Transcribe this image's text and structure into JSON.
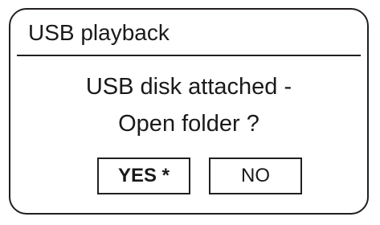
{
  "dialog": {
    "title": "USB playback",
    "message_line1": "USB disk attached -",
    "message_line2": "Open folder ?",
    "buttons": {
      "yes_label": "YES *",
      "no_label": "NO"
    }
  }
}
